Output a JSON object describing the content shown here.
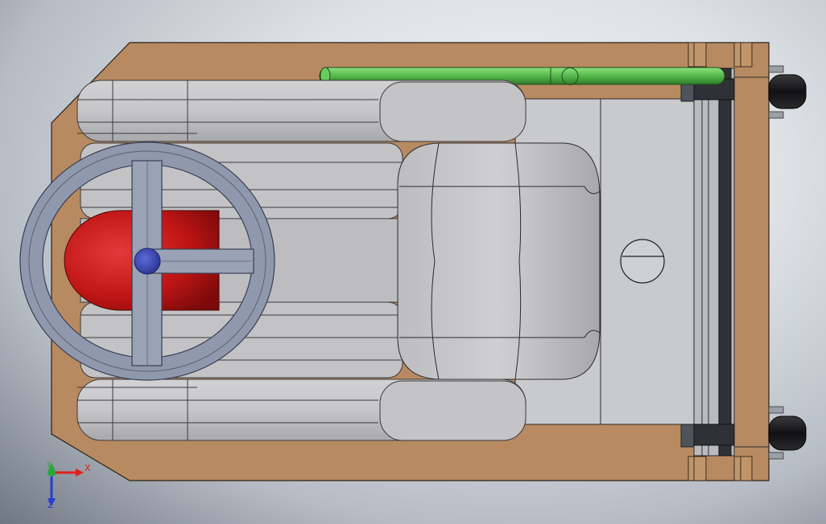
{
  "view": {
    "title": "",
    "part_colors": {
      "base_plate": "#b78a61",
      "seat_gray": "#c2c2c4",
      "steering_wheel": "#9098ad",
      "wheel_hub": "#3b49b3",
      "drum_red": "#c41a1a",
      "bar_green": "#5abf52",
      "frame_dark": "#2e3135",
      "tire_black": "#1c1c1e"
    },
    "triad": {
      "x_label": "X",
      "y_label": "Y",
      "z_label": "Z",
      "x_color": "#e0201c",
      "y_color": "#27a83a",
      "z_color": "#2a3bd8"
    }
  }
}
